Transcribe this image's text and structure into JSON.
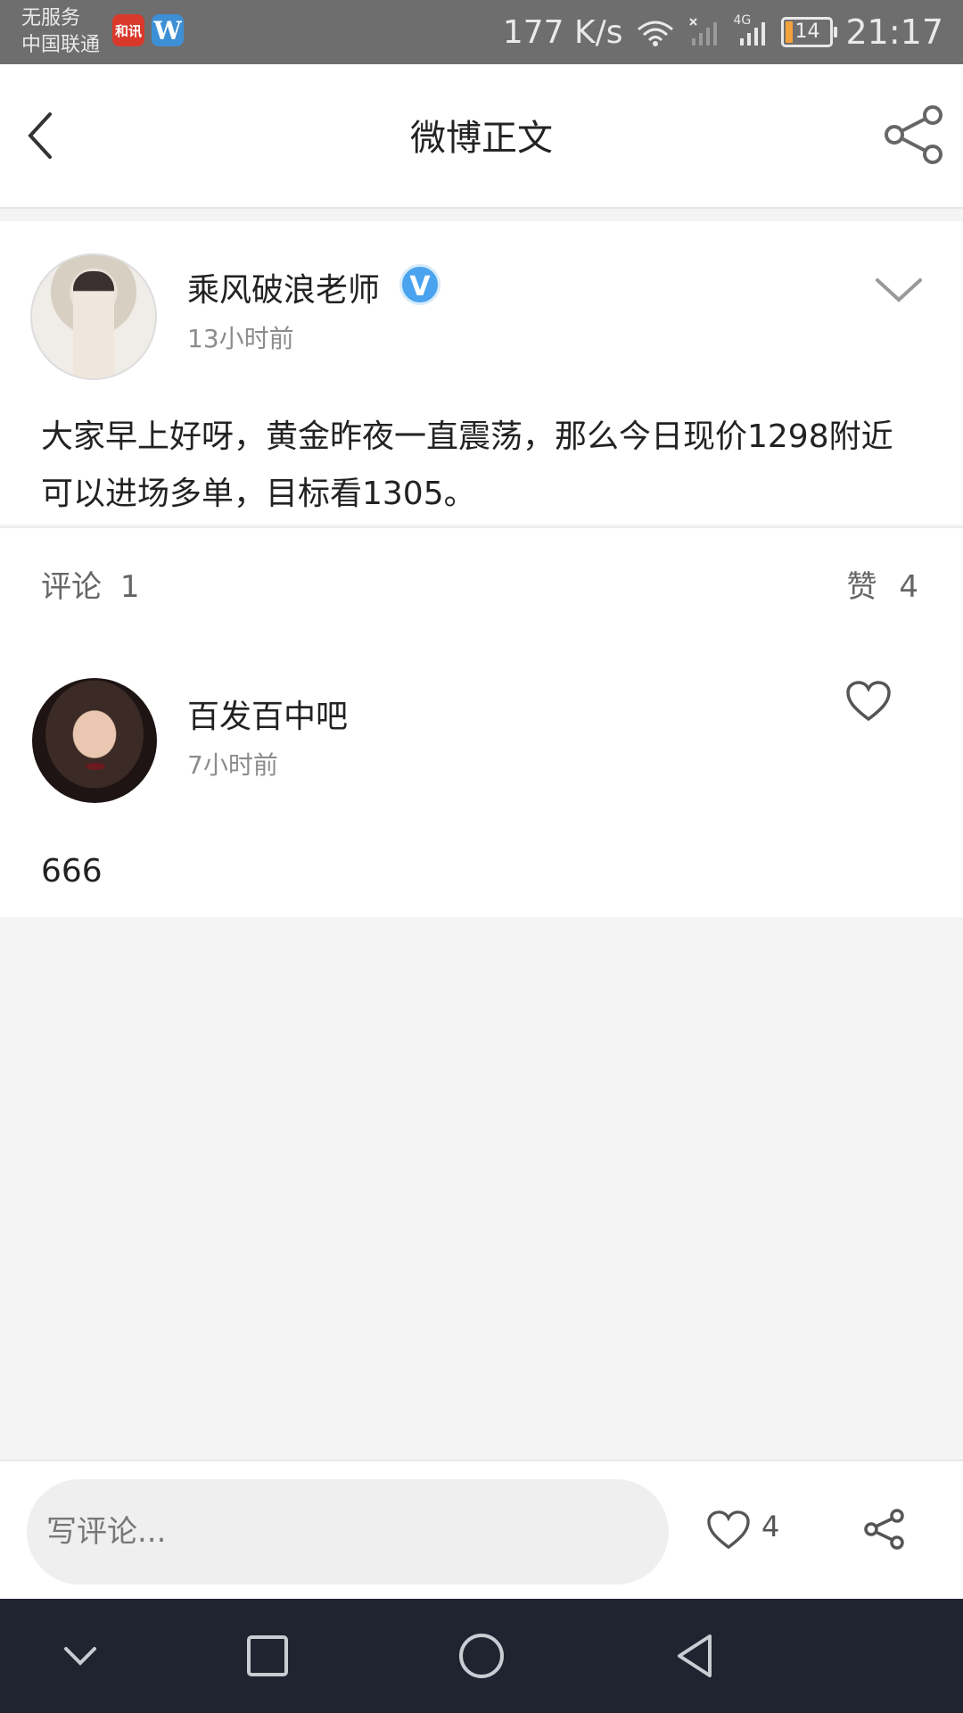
{
  "status_bar": {
    "carrier_line1": "无服务",
    "carrier_line2": "中国联通",
    "app_icon_1_text": "和讯",
    "app_icon_1_color": "#d9392b",
    "app_icon_2_text": "W",
    "app_icon_2_color": "#3d8fd6",
    "net_speed": "177 K/s",
    "network_type": "4G",
    "battery": "14",
    "time": "21:17"
  },
  "header": {
    "title": "微博正文",
    "back_icon": "chevron-left-icon",
    "share_icon": "share-icon"
  },
  "post": {
    "author": "乘风破浪老师",
    "verified_badge": "V",
    "verified_color": "#4aa3ee",
    "time": "13小时前",
    "text": "大家早上好呀，黄金昨夜一直震荡，那么今日现价1298附近可以进场多单，目标看1305。",
    "menu_icon": "chevron-down-icon"
  },
  "stats": {
    "comments_label": "评论",
    "comments_count": "1",
    "likes_label": "赞",
    "likes_count": "4"
  },
  "comments": [
    {
      "author": "百发百中吧",
      "time": "7小时前",
      "text": "666",
      "like_icon": "heart-icon"
    }
  ],
  "bottom_bar": {
    "placeholder": "写评论...",
    "like_count": "4",
    "like_icon": "heart-icon",
    "share_icon": "share-icon"
  },
  "nav_bar": {
    "buttons": [
      "hide-keyboard-icon",
      "recents-icon",
      "home-icon",
      "back-icon"
    ]
  }
}
